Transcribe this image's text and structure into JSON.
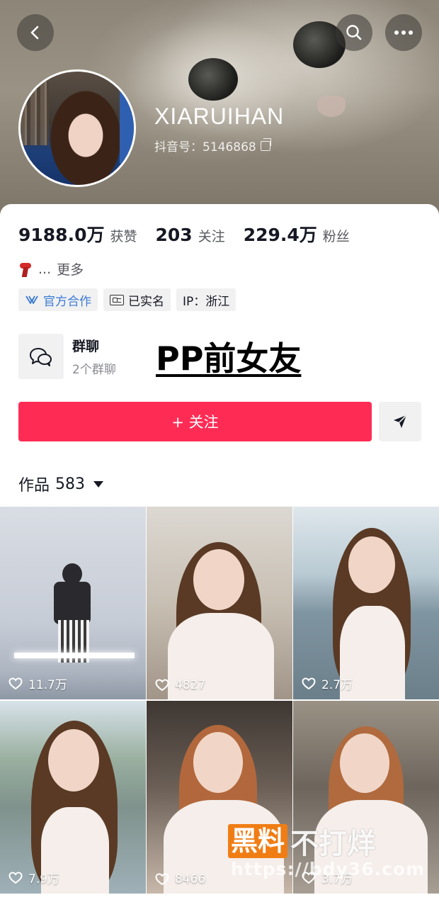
{
  "profile": {
    "username": "XIARUIHAN",
    "douyin_id": "抖音号：5146868"
  },
  "stats": [
    {
      "value": "9188.0万",
      "label": "获赞"
    },
    {
      "value": "203",
      "label": "关注"
    },
    {
      "value": "229.4万",
      "label": "粉丝"
    }
  ],
  "bio": {
    "ellipsis": "...",
    "more": "更多"
  },
  "tags": {
    "official": "官方合作",
    "verified": "已实名",
    "ip": "IP：浙江"
  },
  "group_chat": {
    "title": "群聊",
    "subtitle": "2个群聊"
  },
  "overlay_caption": "PP前女友",
  "actions": {
    "follow": "+ 关注"
  },
  "works": {
    "label": "作品",
    "count": "583"
  },
  "videos": [
    {
      "likes": "11.7万"
    },
    {
      "likes": "4827"
    },
    {
      "likes": "2.7万"
    },
    {
      "likes": "7.9万"
    },
    {
      "likes": "8466"
    },
    {
      "likes": "3.7万"
    }
  ],
  "watermark": {
    "box_text": "黑料",
    "text": "不打烊",
    "url": "https://bdy36.com"
  },
  "colors": {
    "primary_red": "#fe2c55",
    "official_blue": "#3b7bd4",
    "watermark_orange": "#f07d14"
  }
}
